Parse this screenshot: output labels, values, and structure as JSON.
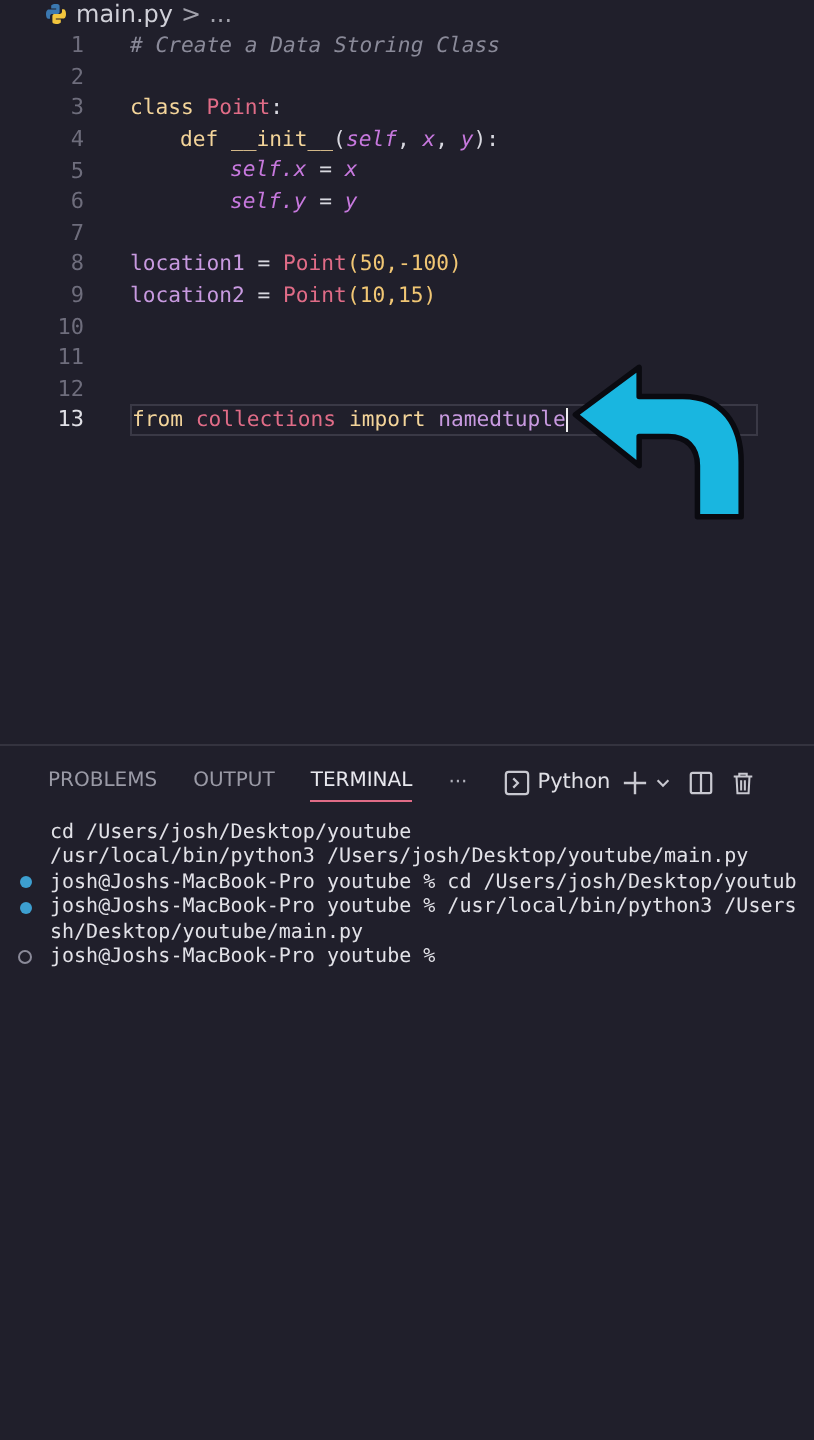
{
  "breadcrumb": {
    "file": "main.py",
    "separator": ">",
    "rest": "..."
  },
  "code_lines": [
    {
      "number": "1",
      "current": false,
      "tokens": [
        {
          "kind": "comment",
          "text": "# Create a Data Storing Class"
        }
      ]
    },
    {
      "number": "2",
      "current": false
    },
    {
      "number": "3",
      "current": false,
      "tokens": [
        {
          "kind": "keyword",
          "text": "class "
        },
        {
          "kind": "class",
          "text": "Point"
        },
        {
          "kind": "plain",
          "text": ":"
        }
      ],
      "children": [
        {
          "number": "4",
          "current": false,
          "tokens": [
            {
              "kind": "keyword",
              "text": "def "
            },
            {
              "kind": "func",
              "text": "__init__"
            },
            {
              "kind": "plain",
              "text": "("
            },
            {
              "kind": "self",
              "text": "self"
            },
            {
              "kind": "plain",
              "text": ", "
            },
            {
              "kind": "self",
              "text": "x"
            },
            {
              "kind": "plain",
              "text": ", "
            },
            {
              "kind": "self",
              "text": "y"
            },
            {
              "kind": "plain",
              "text": "):"
            }
          ],
          "children": [
            {
              "number": "5",
              "current": false,
              "tokens": [
                {
                  "kind": "self",
                  "text": "self.x"
                },
                {
                  "kind": "plain",
                  "text": " = "
                },
                {
                  "kind": "self",
                  "text": "x"
                }
              ]
            },
            {
              "number": "6",
              "current": false,
              "tokens": [
                {
                  "kind": "self",
                  "text": "self.y"
                },
                {
                  "kind": "plain",
                  "text": " = "
                },
                {
                  "kind": "self",
                  "text": "y"
                }
              ]
            }
          ]
        }
      ]
    },
    {
      "number": "7",
      "current": false
    },
    {
      "number": "8",
      "current": false,
      "tokens": [
        {
          "kind": "var",
          "text": "location1"
        },
        {
          "kind": "plain",
          "text": " = "
        },
        {
          "kind": "class",
          "text": "Point"
        },
        {
          "kind": "num",
          "text": "(50,-100)"
        }
      ]
    },
    {
      "number": "9",
      "current": false,
      "tokens": [
        {
          "kind": "var",
          "text": "location2"
        },
        {
          "kind": "plain",
          "text": " = "
        },
        {
          "kind": "class",
          "text": "Point"
        },
        {
          "kind": "num",
          "text": "(10,15)"
        }
      ]
    },
    {
      "number": "10",
      "current": false
    },
    {
      "number": "11",
      "current": false
    },
    {
      "number": "12",
      "current": false
    },
    {
      "number": "13",
      "current": true,
      "tokens": [
        {
          "kind": "keyword",
          "text": "from "
        },
        {
          "kind": "class",
          "text": "collections"
        },
        {
          "kind": "keyword",
          "text": " import "
        },
        {
          "kind": "var",
          "text": "namedtuple"
        }
      ]
    }
  ],
  "panel_tabs": [
    {
      "label": "PROBLEMS",
      "selected": false
    },
    {
      "label": "OUTPUT",
      "selected": false
    },
    {
      "label": "TERMINAL",
      "selected": true
    }
  ],
  "panel_more": "···",
  "terminal_profile": "Python",
  "terminal_lines": [
    {
      "kind": "plain",
      "text": "cd /Users/josh/Desktop/youtube"
    },
    {
      "kind": "plain",
      "text": "/usr/local/bin/python3 /Users/josh/Desktop/youtube/main.py"
    },
    {
      "kind": "success",
      "text": "josh@Joshs-MacBook-Pro youtube % cd /Users/josh/Desktop/youtub"
    },
    {
      "kind": "success",
      "text": "josh@Joshs-MacBook-Pro youtube % /usr/local/bin/python3 /Users"
    },
    {
      "kind": "plain",
      "text": "sh/Desktop/youtube/main.py"
    },
    {
      "kind": "pending",
      "text": "josh@Joshs-MacBook-Pro youtube %"
    }
  ]
}
